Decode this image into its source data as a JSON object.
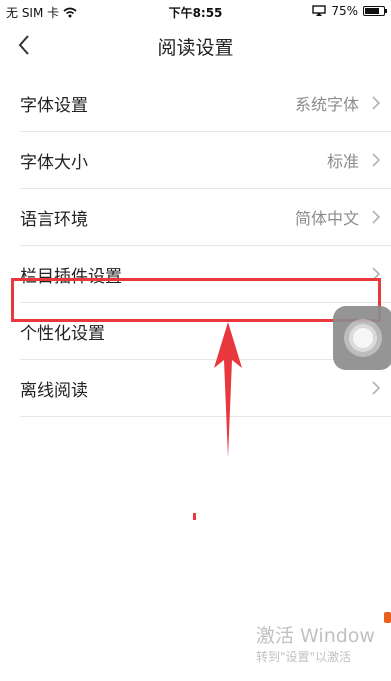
{
  "status_bar": {
    "carrier": "无 SIM 卡",
    "time": "下午8:55",
    "battery_percent": "75%",
    "battery_level": 0.75,
    "wifi_icon": "wifi-icon",
    "airplay_icon": "screen-mirror-icon"
  },
  "nav": {
    "title": "阅读设置",
    "back_icon": "chevron-left-icon"
  },
  "settings": [
    {
      "label": "字体设置",
      "value": "系统字体"
    },
    {
      "label": "字体大小",
      "value": "标准"
    },
    {
      "label": "语言环境",
      "value": "简体中文"
    },
    {
      "label": "栏目插件设置",
      "value": ""
    },
    {
      "label": "个性化设置",
      "value": ""
    },
    {
      "label": "离线阅读",
      "value": ""
    }
  ],
  "annotation": {
    "highlight_color": "#e8383d",
    "highlighted_item": "个性化设置"
  },
  "watermark": {
    "line1": "激活 Window",
    "line2": "转到\"设置\"以激活"
  }
}
